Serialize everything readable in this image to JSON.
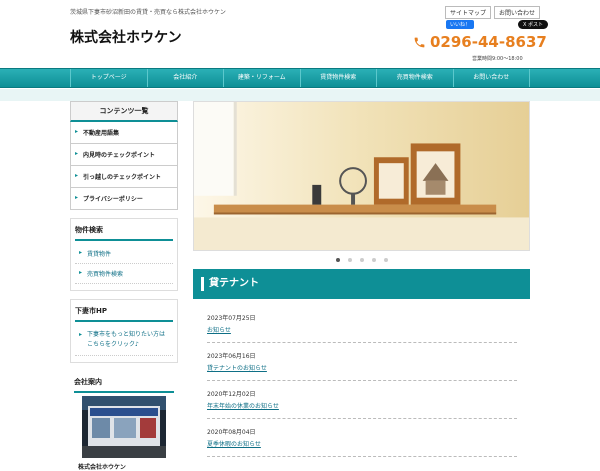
{
  "header": {
    "tagline": "茨城県下妻市砂沼新田の賃貸・売買なら株式会社ホウケン",
    "logo": "株式会社ホウケン",
    "links": [
      "サイトマップ",
      "お問い合わせ"
    ],
    "facebook_label": "いいね！",
    "x_label": "X ポスト",
    "phone": "0296-44-8637",
    "hours": "営業時間9:00～18:00"
  },
  "nav": {
    "items": [
      "トップページ",
      "会社紹介",
      "建築・リフォーム",
      "賃貸物件検索",
      "売買物件検索",
      "お問い合わせ"
    ]
  },
  "sidebar": {
    "contents_title": "コンテンツ一覧",
    "contents": [
      "不動産用語集",
      "内見時のチェックポイント",
      "引っ越しのチェックポイント",
      "プライバシーポリシー"
    ],
    "property": {
      "heading": "物件検索",
      "links": [
        "賃貸物件",
        "売買物件検索"
      ]
    },
    "city": {
      "heading": "下妻市HP",
      "link": "下妻市をもっと知りたい方はこちらをクリック♪"
    },
    "company": {
      "heading": "会社案内",
      "name": "株式会社ホウケン"
    }
  },
  "main": {
    "slider_dots": 5,
    "active_dot": 1,
    "section_title": "貸テナント",
    "news": [
      {
        "date": "2023年07月25日",
        "title": "お知らせ"
      },
      {
        "date": "2023年06月16日",
        "title": "貸テナントのお知らせ"
      },
      {
        "date": "2020年12月02日",
        "title": "年末年始の休業のお知らせ"
      },
      {
        "date": "2020年08月04日",
        "title": "夏季休暇のお知らせ"
      }
    ]
  },
  "colors": {
    "accent": "#0e8f96",
    "phone": "#e77f1f",
    "link": "#0e6f86"
  }
}
